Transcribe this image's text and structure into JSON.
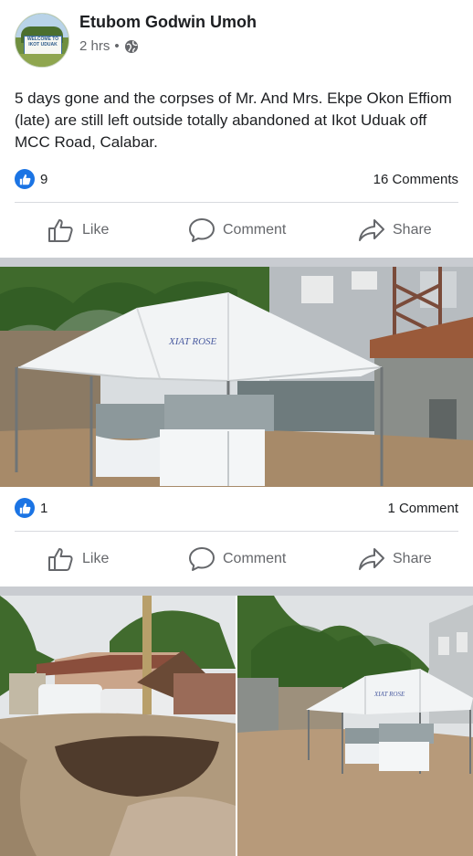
{
  "post": {
    "author": "Etubom Godwin Umoh",
    "time": "2 hrs",
    "dot": "•",
    "text": "5 days gone and the corpses of Mr. And Mrs. Ekpe Okon Effiom (late) are still left outside totally abandoned at Ikot Uduak off MCC Road, Calabar.",
    "reactions": "9",
    "comments": "16 Comments",
    "avatar_sign": [
      "WELCOME TO",
      "IKOT UDUAK"
    ]
  },
  "photo1": {
    "reactions": "1",
    "comments": "1 Comment",
    "tent_text": "XIAT ROSE"
  },
  "photo2": {
    "tent_text": "XIAT ROSE"
  },
  "actions": {
    "like": "Like",
    "comment": "Comment",
    "share": "Share"
  },
  "icons": {
    "privacy": "globe-icon",
    "reaction": "thumbs-up-icon",
    "like": "like-outline-icon",
    "comment": "comment-bubble-icon",
    "share": "share-arrow-icon"
  },
  "colors": {
    "brand_blue": "#1b74e4",
    "text": "#1c1e21",
    "secondary": "#65676b",
    "separator": "#c9ccd1"
  }
}
